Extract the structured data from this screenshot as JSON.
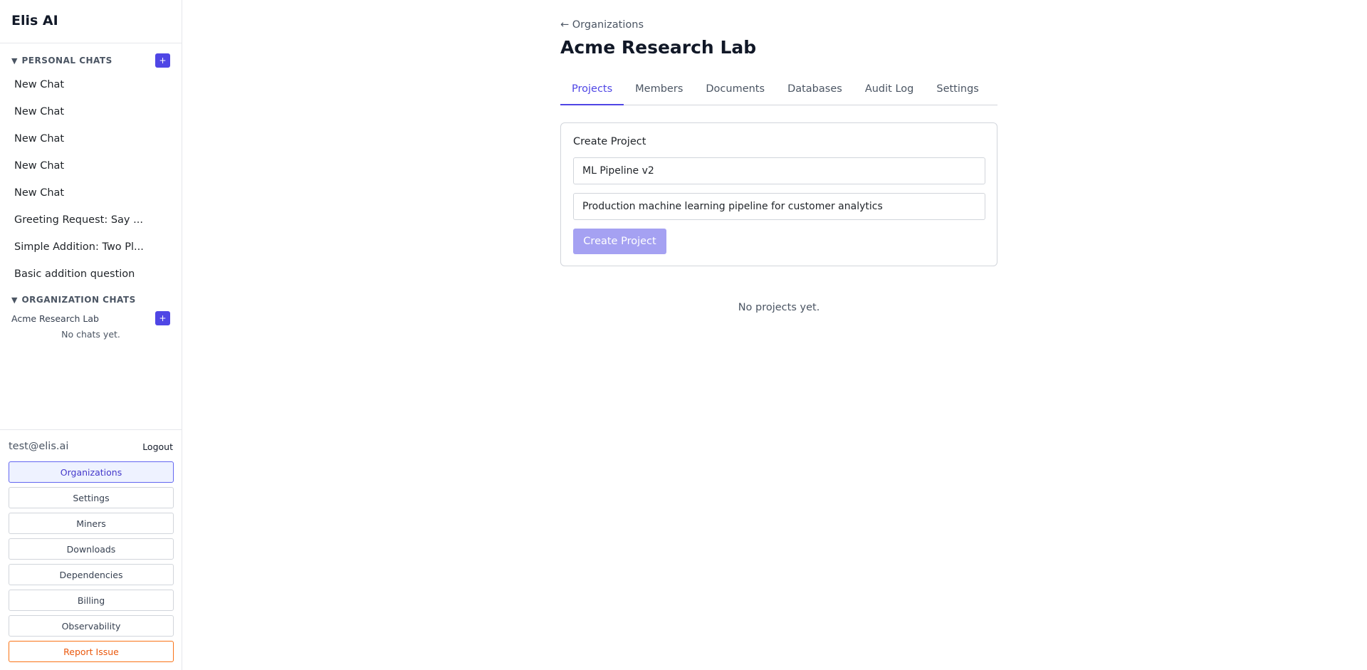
{
  "sidebar": {
    "brand": "Elis AI",
    "personal": {
      "caret": "▼",
      "title": "PERSONAL CHATS",
      "add_label": "+",
      "chats": [
        "New Chat",
        "New Chat",
        "New Chat",
        "New Chat",
        "New Chat",
        "Greeting Request: Say ...",
        "Simple Addition: Two Pl...",
        "Basic addition question"
      ]
    },
    "organization": {
      "caret": "▼",
      "title": "ORGANIZATION CHATS",
      "org_name": "Acme Research Lab",
      "add_label": "+",
      "empty": "No chats yet."
    },
    "footer": {
      "email": "test@elis.ai",
      "logout": "Logout",
      "nav": [
        "Organizations",
        "Settings",
        "Miners",
        "Downloads",
        "Dependencies",
        "Billing",
        "Observability",
        "Report Issue"
      ],
      "active": "Organizations"
    }
  },
  "main": {
    "back_link": "← Organizations",
    "title": "Acme Research Lab",
    "tabs": [
      "Projects",
      "Members",
      "Documents",
      "Databases",
      "Audit Log",
      "Settings"
    ],
    "active_tab": "Projects",
    "create_form": {
      "title": "Create Project",
      "name_value": "ML Pipeline v2",
      "description_value": "Production machine learning pipeline for customer analytics",
      "submit_label": "Create Project"
    },
    "empty_message": "No projects yet."
  },
  "colors": {
    "accent": "#4f46e5",
    "accent_disabled": "#a5a1f2",
    "report": "#ea580c",
    "border": "#d1d5db"
  }
}
